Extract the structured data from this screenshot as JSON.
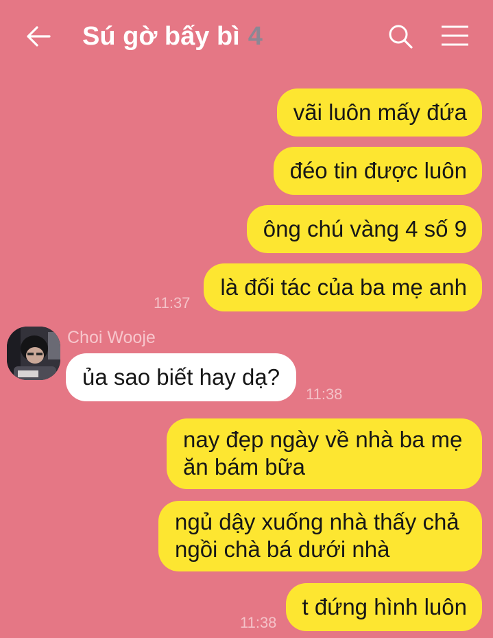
{
  "header": {
    "title": "Sú gờ bấy bì",
    "member_count": "4",
    "back_icon": "arrow-left-icon",
    "search_icon": "search-icon",
    "menu_icon": "hamburger-menu-icon"
  },
  "colors": {
    "background": "#e57785",
    "my_bubble": "#fde631",
    "their_bubble": "#ffffff"
  },
  "messages": [
    {
      "sender": "me",
      "text": "vãi luôn mấy đứa"
    },
    {
      "sender": "me",
      "text": "đéo tin được luôn"
    },
    {
      "sender": "me",
      "text": "ông chú vàng 4 số 9"
    },
    {
      "sender": "me",
      "text": "là đối tác của ba mẹ anh",
      "time": "11:37"
    },
    {
      "sender": "Choi Wooje",
      "text": "ủa sao biết hay dạ?",
      "time": "11:38"
    },
    {
      "sender": "me",
      "text": "nay đẹp ngày về nhà ba mẹ ăn bám bữa"
    },
    {
      "sender": "me",
      "text": "ngủ dậy xuống nhà thấy chả ngồi chà bá dưới nhà"
    },
    {
      "sender": "me",
      "text": "t đứng hình luôn",
      "time": "11:38"
    }
  ]
}
